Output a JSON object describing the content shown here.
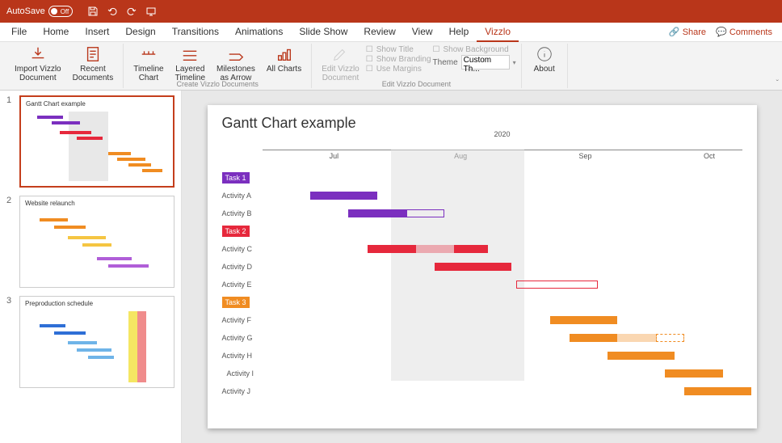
{
  "titlebar": {
    "autosave_label": "AutoSave",
    "autosave_state": "Off"
  },
  "menu": {
    "items": [
      "File",
      "Home",
      "Insert",
      "Design",
      "Transitions",
      "Animations",
      "Slide Show",
      "Review",
      "View",
      "Help",
      "Vizzlo"
    ],
    "active": "Vizzlo",
    "share": "Share",
    "comments": "Comments"
  },
  "ribbon": {
    "import": "Import Vizzlo\nDocument",
    "recent": "Recent\nDocuments",
    "timeline": "Timeline\nChart",
    "layered": "Layered\nTimeline",
    "milestones": "Milestones\nas Arrow",
    "allcharts": "All Charts",
    "edit": "Edit Vizzlo\nDocument",
    "about": "About",
    "group_create": "Create Vizzlo Documents",
    "group_edit": "Edit Vizzlo Document",
    "show_title": "Show Title",
    "show_bg": "Show Background",
    "show_branding": "Show Branding",
    "use_margins": "Use Margins",
    "theme_label": "Theme",
    "theme_value": "Custom Th..."
  },
  "thumbnails": [
    {
      "n": "1",
      "title": "Gantt Chart example",
      "selected": true
    },
    {
      "n": "2",
      "title": "Website relaunch",
      "selected": false
    },
    {
      "n": "3",
      "title": "Preproduction schedule",
      "selected": false
    }
  ],
  "slide": {
    "title": "Gantt Chart example"
  },
  "chart_data": {
    "type": "gantt",
    "title": "Gantt Chart example",
    "year": "2020",
    "months": [
      "Jul",
      "Aug",
      "Sep",
      "Oct"
    ],
    "month_positions_pct": [
      14,
      40,
      66,
      92
    ],
    "shade_range_pct": [
      27,
      55
    ],
    "groups": [
      {
        "name": "Task 1",
        "color": "#7b2fbf",
        "rows": [
          {
            "name": "Activity A",
            "segments": [
              {
                "start": 10,
                "end": 24,
                "style": "solid"
              },
              {
                "start": 18,
                "end": 24,
                "style": "faded"
              }
            ]
          },
          {
            "name": "Activity B",
            "segments": [
              {
                "start": 18,
                "end": 30,
                "style": "solid"
              },
              {
                "start": 30,
                "end": 38,
                "style": "outline"
              }
            ]
          }
        ]
      },
      {
        "name": "Task 2",
        "color": "#e6283c",
        "rows": [
          {
            "name": "Activity C",
            "segments": [
              {
                "start": 22,
                "end": 32,
                "style": "solid"
              },
              {
                "start": 32,
                "end": 40,
                "style": "faded"
              },
              {
                "start": 40,
                "end": 47,
                "style": "solid"
              }
            ]
          },
          {
            "name": "Activity D",
            "segments": [
              {
                "start": 36,
                "end": 52,
                "style": "solid"
              }
            ]
          },
          {
            "name": "Activity E",
            "segments": [
              {
                "start": 53,
                "end": 70,
                "style": "outline"
              }
            ]
          }
        ]
      },
      {
        "name": "Task 3",
        "color": "#f08c22",
        "rows": [
          {
            "name": "Activity F",
            "segments": [
              {
                "start": 60,
                "end": 74,
                "style": "solid"
              }
            ]
          },
          {
            "name": "Activity G",
            "segments": [
              {
                "start": 64,
                "end": 74,
                "style": "solid"
              },
              {
                "start": 74,
                "end": 82,
                "style": "faded"
              },
              {
                "start": 82,
                "end": 88,
                "style": "dashed-outline"
              }
            ]
          },
          {
            "name": "Activity H",
            "segments": [
              {
                "start": 72,
                "end": 86,
                "style": "solid"
              }
            ]
          },
          {
            "name": "Activity I",
            "segments": [
              {
                "start": 84,
                "end": 96,
                "style": "solid"
              }
            ],
            "indent": true
          },
          {
            "name": "Activity J",
            "segments": [
              {
                "start": 88,
                "end": 102,
                "style": "solid"
              }
            ]
          }
        ]
      }
    ]
  }
}
